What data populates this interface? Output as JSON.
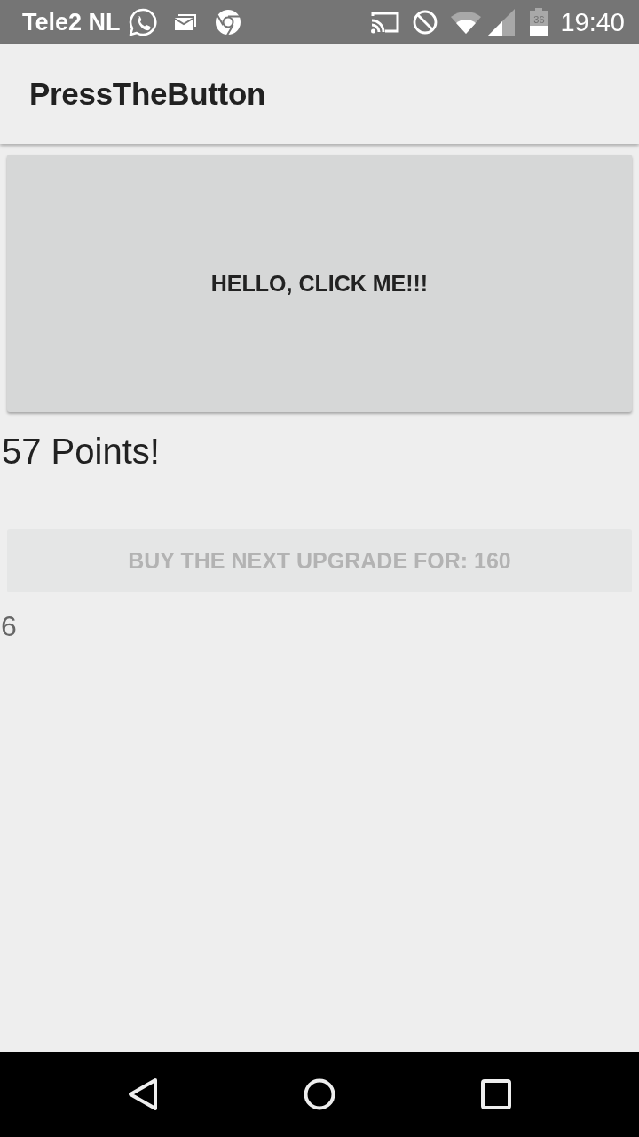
{
  "status_bar": {
    "carrier": "Tele2 NL",
    "battery_text": "36",
    "time": "19:40"
  },
  "app_bar": {
    "title": "PressTheButton"
  },
  "main_button": {
    "label": "HELLO, CLICK ME!!!"
  },
  "points": "57 Points!",
  "upgrade_button": {
    "label": "BUY THE NEXT UPGRADE FOR: 160",
    "disabled": true
  },
  "level_text": "6"
}
